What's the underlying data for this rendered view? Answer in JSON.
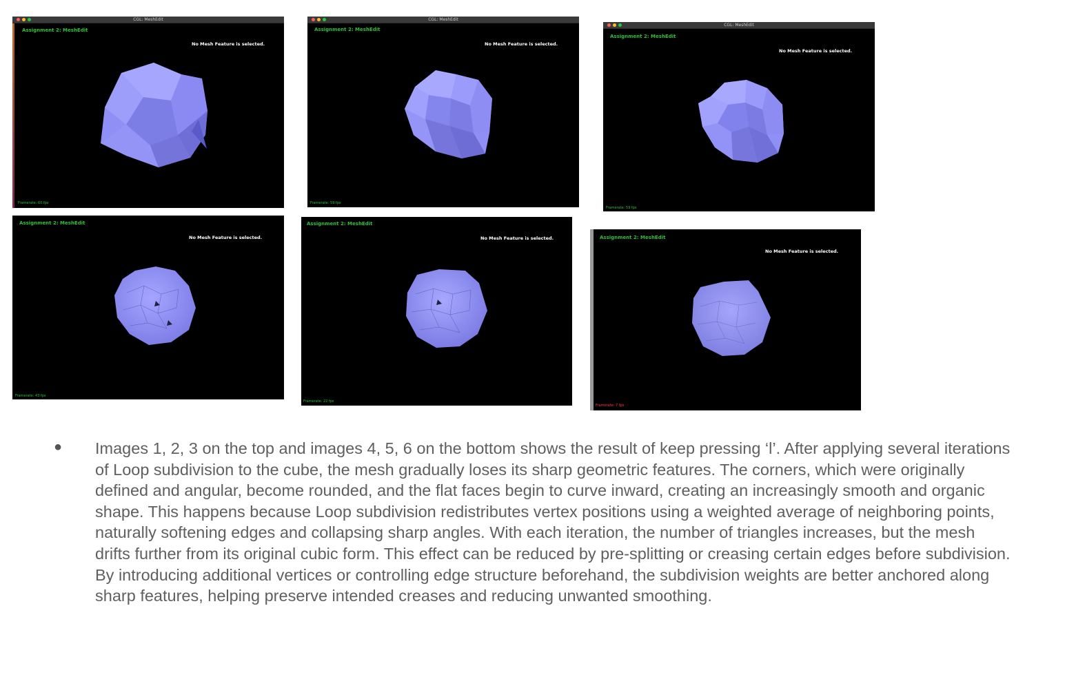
{
  "window_title": "CGL: MeshEdit",
  "app_title": "Assignment 2: MeshEdit",
  "status_text": "No Mesh Feature is selected.",
  "mesh_color": "#8f8ff5",
  "screenshots": [
    {
      "fps_label": "Framerate: 60 fps",
      "fps_color": "#2fbf3a"
    },
    {
      "fps_label": "Framerate: 59 fps",
      "fps_color": "#2fbf3a"
    },
    {
      "fps_label": "Framerate: 59 fps",
      "fps_color": "#2fbf3a"
    },
    {
      "fps_label": "Framerate: 43 fps",
      "fps_color": "#2fbf3a"
    },
    {
      "fps_label": "Framerate: 22 fps",
      "fps_color": "#2fbf3a"
    },
    {
      "fps_label": "Framerate: 7 fps",
      "fps_color": "#ff3b3b"
    }
  ],
  "bullet": {
    "text": "Images 1, 2, 3 on the top and images 4, 5, 6 on the bottom shows the result of keep pressing ‘l’. After applying several iterations of Loop subdivision to the cube, the mesh gradually loses its sharp geometric features. The corners, which were originally defined and angular, become rounded, and the flat faces begin to curve inward, creating an increasingly smooth and organic shape. This happens because Loop subdivision redistributes vertex positions using a weighted average of neighboring points, naturally softening edges and collapsing sharp angles. With each iteration, the number of triangles increases, but the mesh drifts further from its original cubic form. This effect can be reduced by pre-splitting or creasing certain edges before subdivision. By introducing additional vertices or controlling edge structure beforehand, the subdivision weights are better anchored along sharp features, helping preserve intended creases and reducing unwanted smoothing."
  }
}
